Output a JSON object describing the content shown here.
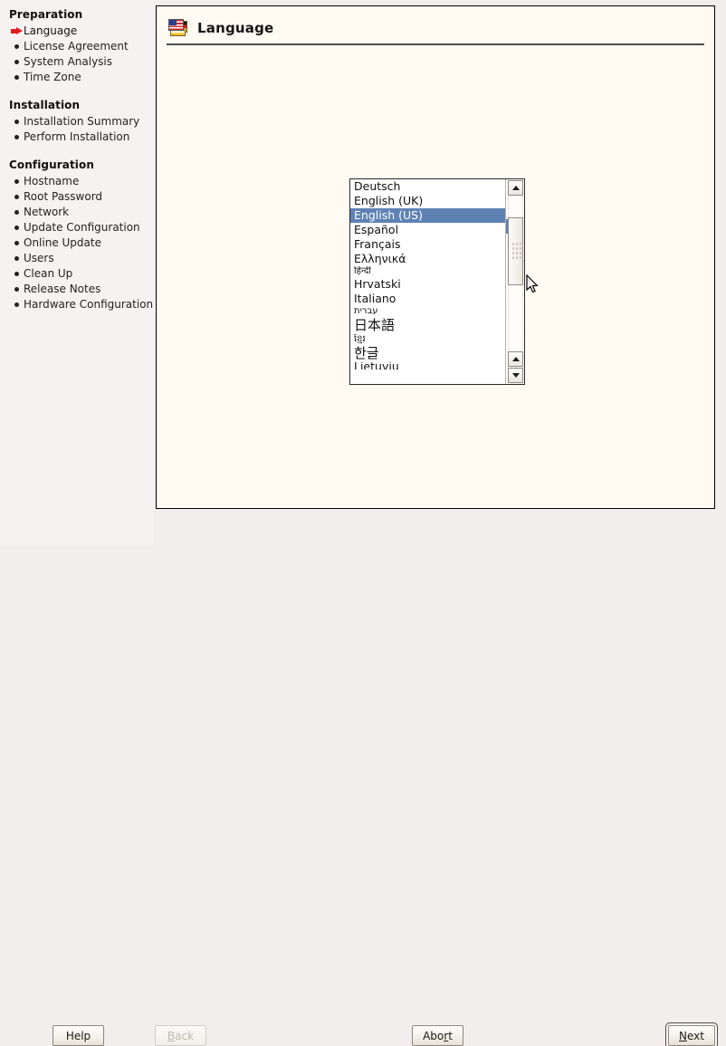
{
  "window": {
    "background_color": "#f3eeee",
    "panel_color": "#fffaf2",
    "accent_selection_color": "#5f82b4",
    "arrow_marker_color": "#e01b1b"
  },
  "sidebar": {
    "groups": [
      {
        "title": "Preparation",
        "items": [
          {
            "label": "Language",
            "marker": "arrow-icon",
            "current": true
          },
          {
            "label": "License Agreement",
            "marker": "bullet-icon",
            "current": false
          },
          {
            "label": "System Analysis",
            "marker": "bullet-icon",
            "current": false
          },
          {
            "label": "Time Zone",
            "marker": "bullet-icon",
            "current": false
          }
        ]
      },
      {
        "title": "Installation",
        "items": [
          {
            "label": "Installation Summary",
            "marker": "bullet-icon",
            "current": false
          },
          {
            "label": "Perform Installation",
            "marker": "bullet-icon",
            "current": false
          }
        ]
      },
      {
        "title": "Configuration",
        "items": [
          {
            "label": "Hostname",
            "marker": "bullet-icon",
            "current": false
          },
          {
            "label": "Root Password",
            "marker": "bullet-icon",
            "current": false
          },
          {
            "label": "Network",
            "marker": "bullet-icon",
            "current": false
          },
          {
            "label": "Update Configuration",
            "marker": "bullet-icon",
            "current": false
          },
          {
            "label": "Online Update",
            "marker": "bullet-icon",
            "current": false
          },
          {
            "label": "Users",
            "marker": "bullet-icon",
            "current": false
          },
          {
            "label": "Clean Up",
            "marker": "bullet-icon",
            "current": false
          },
          {
            "label": "Release Notes",
            "marker": "bullet-icon",
            "current": false
          },
          {
            "label": "Hardware Configuration",
            "marker": "bullet-icon",
            "current": false
          }
        ]
      }
    ]
  },
  "header": {
    "title": "Language",
    "icon": "flag-stack-icon"
  },
  "language_list": {
    "selected": "English (US)",
    "items": [
      {
        "label": "Deutsch",
        "style": "normal"
      },
      {
        "label": "English (UK)",
        "style": "normal"
      },
      {
        "label": "English (US)",
        "style": "normal"
      },
      {
        "label": "Español",
        "style": "normal"
      },
      {
        "label": "Français",
        "style": "normal"
      },
      {
        "label": "Ελληνικά",
        "style": "normal"
      },
      {
        "label": "हिन्दी",
        "style": "small"
      },
      {
        "label": "Hrvatski",
        "style": "normal"
      },
      {
        "label": "Italiano",
        "style": "normal"
      },
      {
        "label": "עברית",
        "style": "small"
      },
      {
        "label": "日本語",
        "style": "tall"
      },
      {
        "label": "ខ្មែរ",
        "style": "small"
      },
      {
        "label": "한글",
        "style": "tall"
      },
      {
        "label": "Lietuvių",
        "style": "clipped"
      }
    ],
    "scrollbar": {
      "up_arrow_top": "triangle-up-icon",
      "up_arrow_bottom": "triangle-up-icon",
      "down_arrow_bottom": "triangle-down-icon"
    }
  },
  "buttons": {
    "help": {
      "label": "Help",
      "accel": "",
      "disabled": false,
      "focused": false
    },
    "back": {
      "label": "Back",
      "accel": "B",
      "disabled": true,
      "focused": false
    },
    "abort": {
      "label": "Abort",
      "accel": "r",
      "disabled": false,
      "focused": false
    },
    "next": {
      "label": "Next",
      "accel": "N",
      "disabled": false,
      "focused": true
    }
  }
}
